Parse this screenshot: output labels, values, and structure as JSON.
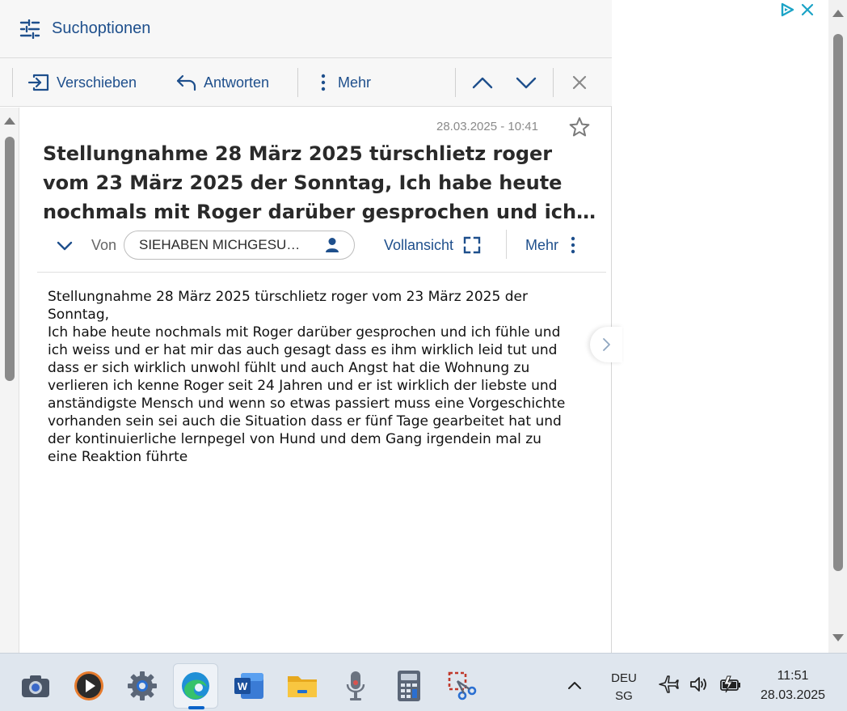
{
  "search": {
    "label": "Suchoptionen"
  },
  "toolbar": {
    "move_label": "Verschieben",
    "reply_label": "Antworten",
    "more_label": "Mehr"
  },
  "message": {
    "date": "28.03.2025 - 10:41",
    "subject_lines": [
      "Stellungnahme 28 März 2025 türschlietz roger",
      "vom 23 März 2025 der Sonntag, Ich habe heute",
      "nochmals mit Roger darüber gesprochen und ich…"
    ],
    "from_label": "Von",
    "sender": "SIEHABEN MICHGESU…",
    "fullview_label": "Vollansicht",
    "more_label": "Mehr",
    "body_lines": [
      "Stellungnahme 28 März 2025 türschlietz roger vom 23 März 2025 der",
      "Sonntag,",
      "Ich habe heute nochmals mit Roger darüber gesprochen und ich fühle und",
      "ich weiss und er hat mir das auch gesagt dass es ihm wirklich leid tut und",
      "dass er sich wirklich unwohl fühlt und auch Angst hat die Wohnung zu",
      "verlieren ich kenne Roger seit 24 Jahren und er ist wirklich der liebste und",
      "anständigste Mensch und wenn so etwas passiert muss eine Vorgeschichte",
      "vorhanden sein sei auch die Situation dass er fünf Tage gearbeitet hat und",
      "der kontinuierliche lernpegel von Hund und dem Gang irgendein mal zu",
      "eine Reaktion führte"
    ]
  },
  "taskbar": {
    "apps": [
      "camera-app",
      "media-player-app",
      "settings-app",
      "edge-browser",
      "word-app",
      "file-explorer",
      "voice-recorder-app",
      "calculator-app",
      "snipping-tool"
    ],
    "lang_line1": "DEU",
    "lang_line2": "SG",
    "time": "11:51",
    "date": "28.03.2025"
  },
  "colors": {
    "accent": "#1e4f8c",
    "taskbar": "#dfe6ee",
    "active_indicator": "#0a63c9"
  }
}
